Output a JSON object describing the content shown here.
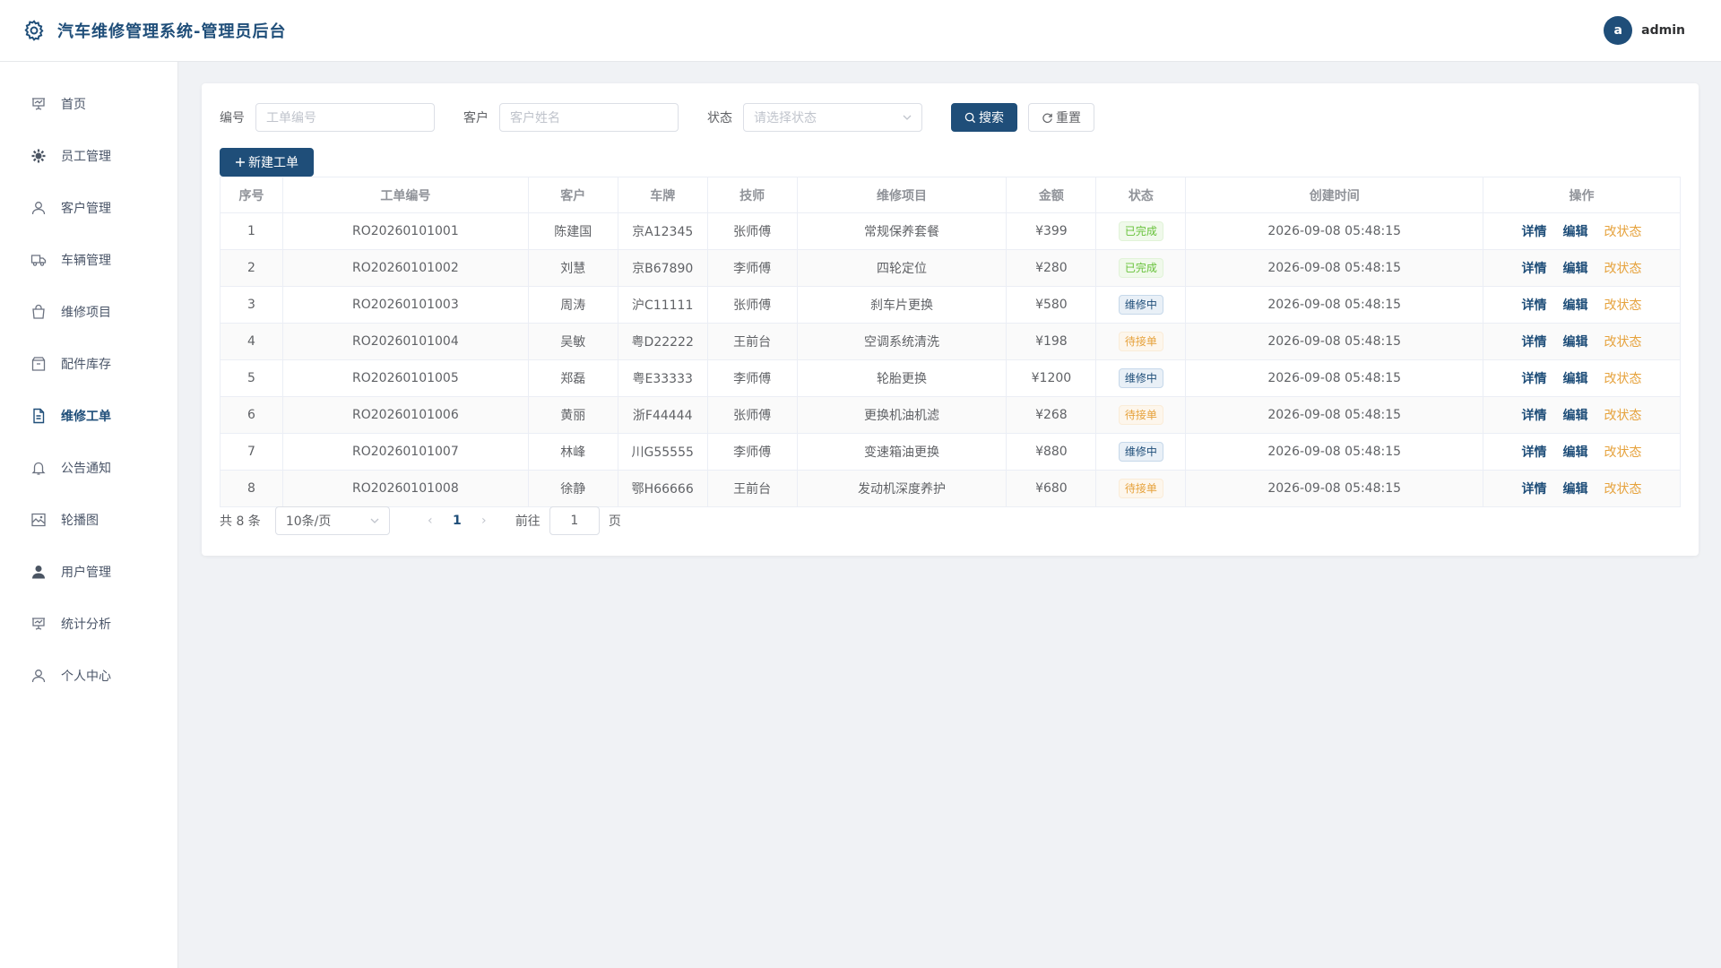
{
  "header": {
    "title": "汽车维修管理系统-管理员后台",
    "avatar_letter": "a",
    "username": "admin"
  },
  "sidebar": {
    "items": [
      {
        "label": "首页",
        "icon": "dashboard-icon"
      },
      {
        "label": "员工管理",
        "icon": "gear-icon"
      },
      {
        "label": "客户管理",
        "icon": "user-icon"
      },
      {
        "label": "车辆管理",
        "icon": "truck-icon"
      },
      {
        "label": "维修项目",
        "icon": "bag-icon"
      },
      {
        "label": "配件库存",
        "icon": "box-icon"
      },
      {
        "label": "维修工单",
        "icon": "document-icon",
        "active": true
      },
      {
        "label": "公告通知",
        "icon": "bell-icon"
      },
      {
        "label": "轮播图",
        "icon": "picture-icon"
      },
      {
        "label": "用户管理",
        "icon": "avatar-icon"
      },
      {
        "label": "统计分析",
        "icon": "chart-icon"
      },
      {
        "label": "个人中心",
        "icon": "person-icon"
      }
    ]
  },
  "filters": {
    "code_label": "编号",
    "code_placeholder": "工单编号",
    "customer_label": "客户",
    "customer_placeholder": "客户姓名",
    "status_label": "状态",
    "status_placeholder": "请选择状态",
    "search_label": "搜索",
    "reset_label": "重置"
  },
  "new_button_label": "新建工单",
  "table": {
    "headers": [
      "序号",
      "工单编号",
      "客户",
      "车牌",
      "技师",
      "维修项目",
      "金额",
      "状态",
      "创建时间",
      "操作"
    ],
    "actions": {
      "detail": "详情",
      "edit": "编辑",
      "change_status": "改状态"
    },
    "rows": [
      {
        "no": "1",
        "code": "RO20260101001",
        "customer": "陈建国",
        "plate": "京A12345",
        "tech": "张师傅",
        "item": "常规保养套餐",
        "amount": "¥399",
        "status": "已完成",
        "status_type": "done",
        "created": "2026-09-08 05:48:15"
      },
      {
        "no": "2",
        "code": "RO20260101002",
        "customer": "刘慧",
        "plate": "京B67890",
        "tech": "李师傅",
        "item": "四轮定位",
        "amount": "¥280",
        "status": "已完成",
        "status_type": "done",
        "created": "2026-09-08 05:48:15"
      },
      {
        "no": "3",
        "code": "RO20260101003",
        "customer": "周涛",
        "plate": "沪C11111",
        "tech": "张师傅",
        "item": "刹车片更换",
        "amount": "¥580",
        "status": "维修中",
        "status_type": "repair",
        "created": "2026-09-08 05:48:15"
      },
      {
        "no": "4",
        "code": "RO20260101004",
        "customer": "吴敏",
        "plate": "粤D22222",
        "tech": "王前台",
        "item": "空调系统清洗",
        "amount": "¥198",
        "status": "待接单",
        "status_type": "wait",
        "created": "2026-09-08 05:48:15"
      },
      {
        "no": "5",
        "code": "RO20260101005",
        "customer": "郑磊",
        "plate": "粤E33333",
        "tech": "李师傅",
        "item": "轮胎更换",
        "amount": "¥1200",
        "status": "维修中",
        "status_type": "repair",
        "created": "2026-09-08 05:48:15"
      },
      {
        "no": "6",
        "code": "RO20260101006",
        "customer": "黄丽",
        "plate": "浙F44444",
        "tech": "张师傅",
        "item": "更换机油机滤",
        "amount": "¥268",
        "status": "待接单",
        "status_type": "wait",
        "created": "2026-09-08 05:48:15"
      },
      {
        "no": "7",
        "code": "RO20260101007",
        "customer": "林峰",
        "plate": "川G55555",
        "tech": "李师傅",
        "item": "变速箱油更换",
        "amount": "¥880",
        "status": "维修中",
        "status_type": "repair",
        "created": "2026-09-08 05:48:15"
      },
      {
        "no": "8",
        "code": "RO20260101008",
        "customer": "徐静",
        "plate": "鄂H66666",
        "tech": "王前台",
        "item": "发动机深度养护",
        "amount": "¥680",
        "status": "待接单",
        "status_type": "wait",
        "created": "2026-09-08 05:48:15"
      }
    ]
  },
  "pagination": {
    "total": "共 8 条",
    "page_size": "10条/页",
    "current_page": "1",
    "goto_label": "前往",
    "goto_value": "1",
    "page_suffix": "页"
  },
  "colors": {
    "primary": "#1f4e79",
    "done": "#67c23a",
    "wait": "#e6a23c"
  }
}
